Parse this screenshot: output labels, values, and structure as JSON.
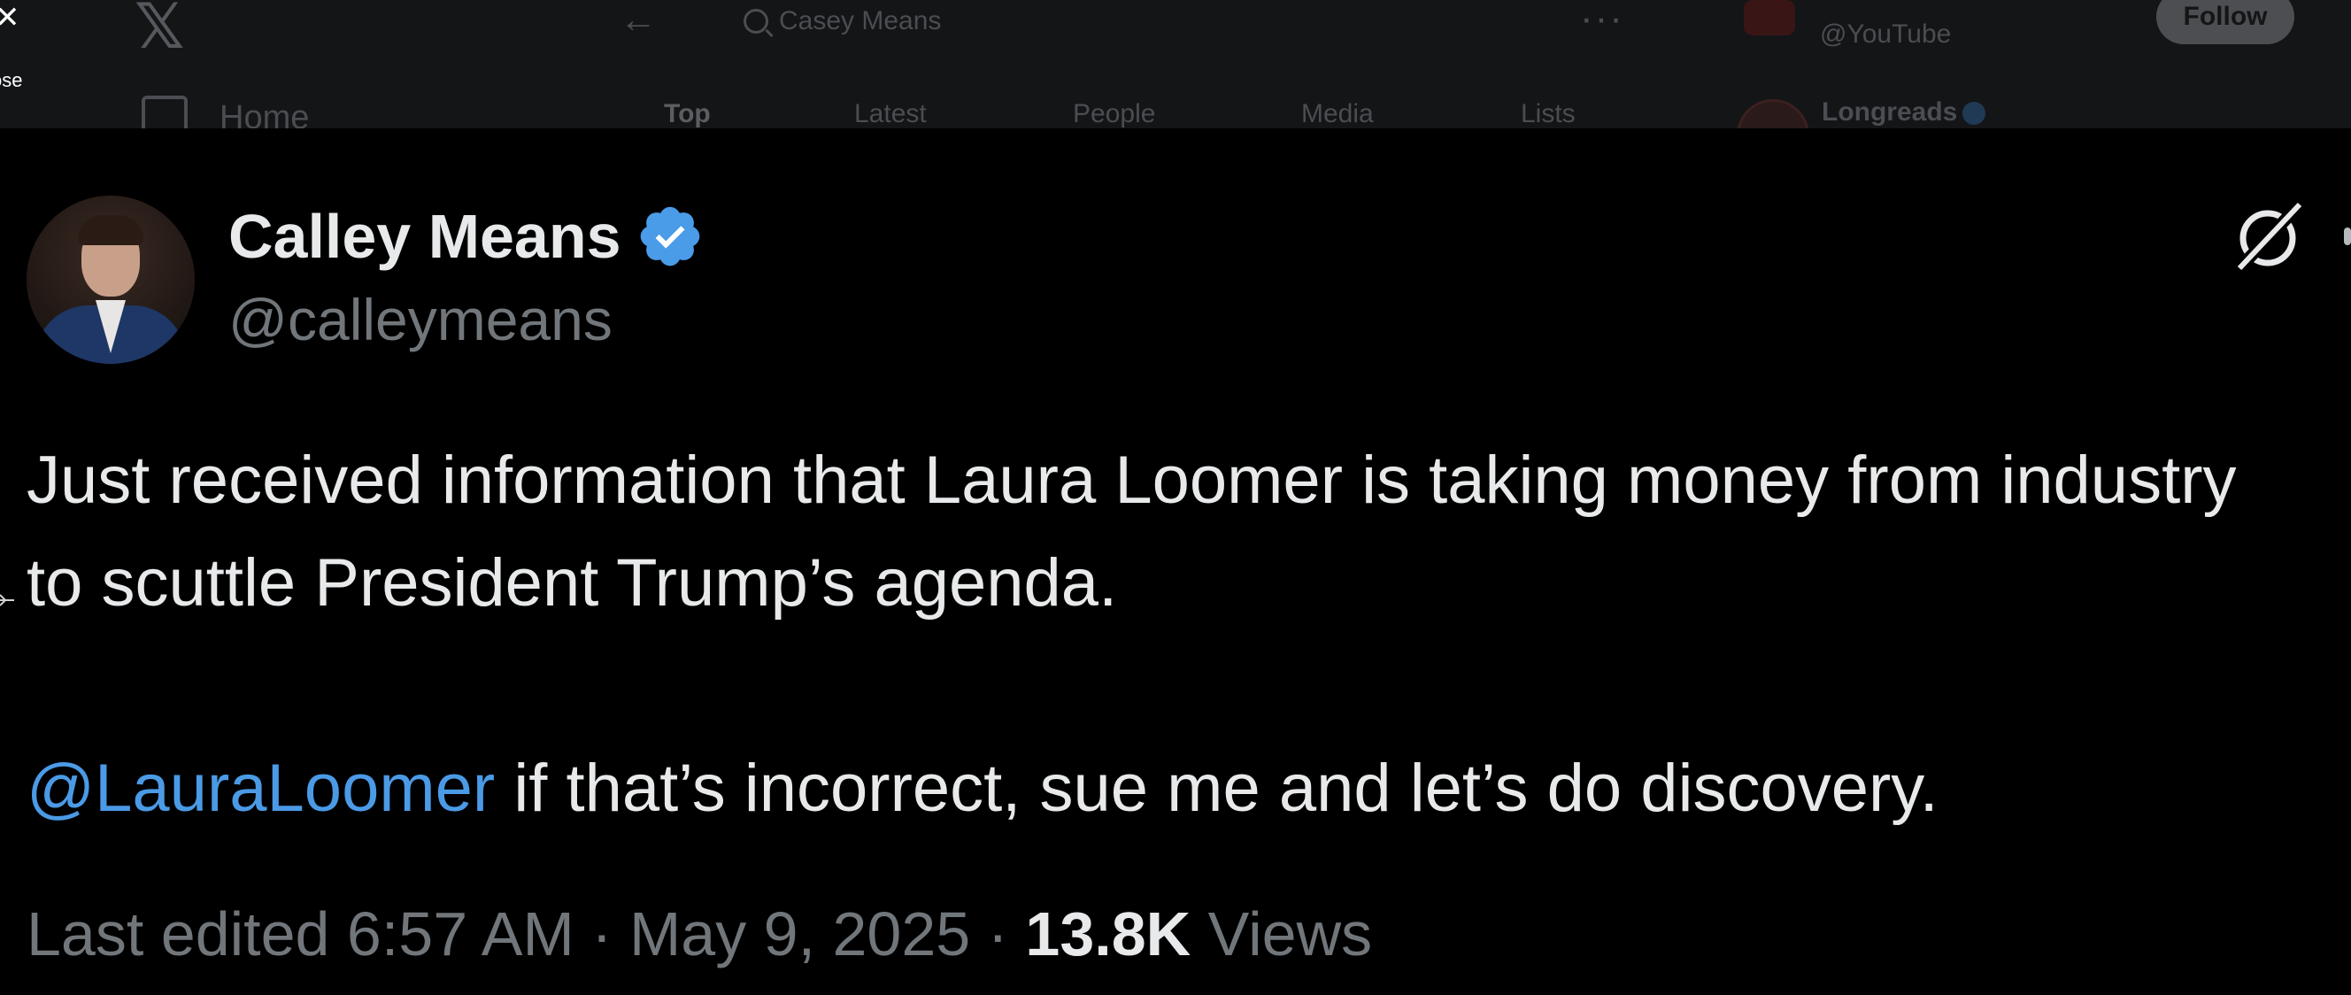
{
  "background_app": {
    "search_value": "Casey Means",
    "nav_home_label": "Home",
    "tabs": [
      "Top",
      "Latest",
      "People",
      "Media",
      "Lists"
    ],
    "right_rail": {
      "account1_handle": "@YouTube",
      "follow_label": "Follow",
      "account2_name": "Longreads"
    }
  },
  "close": {
    "label": "ose"
  },
  "tweet": {
    "display_name": "Calley Means",
    "handle": "@calleymeans",
    "verified": true,
    "paragraph1": "Just received information that Laura Loomer is taking money from industry to scuttle President Trump’s agenda.",
    "mention": "@LauraLoomer",
    "paragraph2_rest": " if that’s incorrect, sue me and let’s do discovery.",
    "edited_prefix": "Last edited 6:57 AM · May 9, 2025 · ",
    "views_count": "13.8K",
    "views_label": " Views"
  },
  "colors": {
    "background": "#000000",
    "text": "#e7e9ea",
    "secondary_text": "#71767b",
    "link": "#4b9ae6",
    "verified_badge": "#4a9be8"
  },
  "icons": [
    "x-logo-icon",
    "back-arrow-icon",
    "search-icon",
    "more-icon",
    "home-icon",
    "close-icon",
    "verified-badge-icon",
    "grok-icon"
  ]
}
